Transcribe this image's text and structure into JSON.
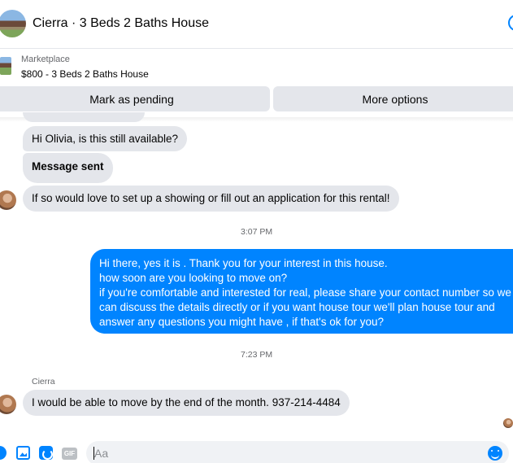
{
  "header": {
    "contact_name": "Cierra",
    "title": "Cierra · 3 Beds 2 Baths House"
  },
  "listing": {
    "source_label": "Marketplace",
    "title": "$800 - 3 Beds 2 Baths House"
  },
  "actions": {
    "mark_pending_label": "Mark as pending",
    "more_options_label": "More options"
  },
  "messages": [
    {
      "sender": "Cierra",
      "direction": "incoming",
      "text": "Hi Olivia, is this still available?"
    },
    {
      "sender": "Cierra",
      "direction": "incoming",
      "text": "Message sent"
    },
    {
      "sender": "Cierra",
      "direction": "incoming",
      "text": "If so would love to set up a showing or fill out an application for this rental!"
    },
    {
      "direction": "outgoing",
      "lines": [
        "Hi there, yes it is . Thank you for your interest in this house.",
        "how soon are you looking to move on?",
        "if you're comfortable and interested for real, please share your contact number so we",
        "can discuss the details directly or if you  want house tour we'll plan house tour and",
        "answer any questions you might have , if that's ok for you?"
      ]
    },
    {
      "sender": "Cierra",
      "direction": "incoming",
      "text": "I would be able to move by the end of the month. 937-214-4484"
    }
  ],
  "timestamps": [
    "3:07 PM",
    "7:23 PM"
  ],
  "sender_label": "Cierra",
  "composer": {
    "placeholder": "Aa",
    "gif_label": "GIF"
  },
  "icons": {
    "plus": "plus-circle-icon",
    "photo": "photo-icon",
    "sticker": "sticker-icon",
    "gif": "gif-icon",
    "emoji": "emoji-icon"
  },
  "colors": {
    "accent": "#0084ff",
    "incoming_bubble": "#e4e6eb",
    "outgoing_text": "#ffffff",
    "muted_text": "#65676b"
  }
}
